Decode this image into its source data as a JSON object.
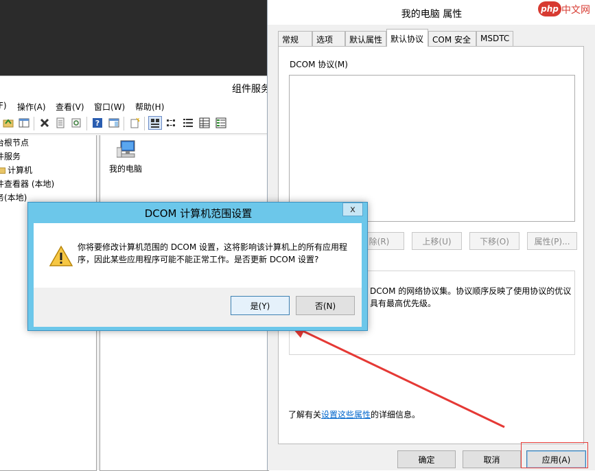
{
  "component_window": {
    "title": "组件服务",
    "menu": [
      "F)",
      "操作(A)",
      "查看(V)",
      "窗口(W)",
      "帮助(H)"
    ],
    "tree": [
      "台根节点",
      "件服务",
      "计算机",
      "件查看器 (本地)",
      "务(本地)"
    ],
    "content_item": "我的电脑"
  },
  "props_dialog": {
    "title": "我的电脑 属性",
    "tabs": [
      "常规",
      "选项",
      "默认属性",
      "默认协议",
      "COM 安全",
      "MSDTC"
    ],
    "protocols_label": "DCOM 协议(M)",
    "buttons": {
      "remove": "除(R)",
      "move_up": "上移(U)",
      "move_down": "下移(O)",
      "properties": "属性(P)..."
    },
    "description": "DCOM 的网络协议集。协议顺序反映了使用协议的优议具有最高优先级。",
    "more_info_prefix": "了解有关",
    "more_info_link": "设置这些属性",
    "more_info_suffix": "的详细信息。",
    "ok": "确定",
    "cancel": "取消",
    "apply": "应用(A)"
  },
  "dcom_dialog": {
    "title": "DCOM 计算机范围设置",
    "close": "x",
    "message": "你将要修改计算机范围的 DCOM 设置，这将影响该计算机上的所有应用程序，因此某些应用程序可能不能正常工作。是否更新 DCOM 设置?",
    "yes": "是(Y)",
    "no": "否(N)"
  },
  "watermark": {
    "badge": "php",
    "text": "中文网"
  },
  "colors": {
    "modal_frame": "#6cc7ea",
    "annotation_red": "#e53935",
    "link_blue": "#0066cc"
  }
}
